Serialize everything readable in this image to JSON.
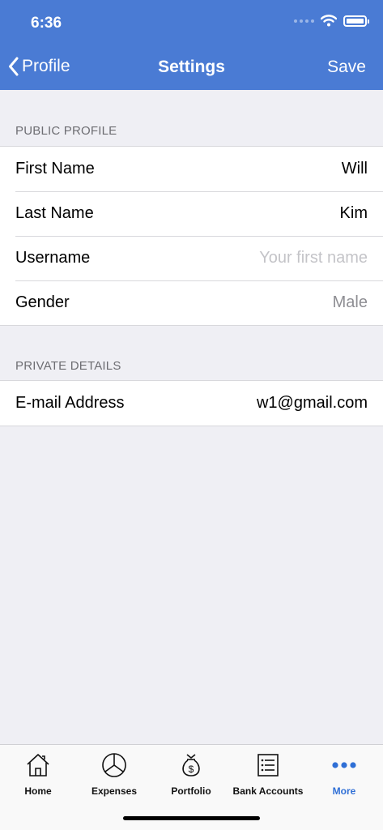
{
  "status_bar": {
    "time": "6:36",
    "icons": [
      "signal-dots-icon",
      "wifi-icon",
      "battery-icon"
    ]
  },
  "nav": {
    "back_label": "Profile",
    "title": "Settings",
    "save_label": "Save"
  },
  "sections": [
    {
      "header": "PUBLIC PROFILE",
      "rows": [
        {
          "label": "First Name",
          "value": "Will",
          "placeholder": ""
        },
        {
          "label": "Last Name",
          "value": "Kim",
          "placeholder": ""
        },
        {
          "label": "Username",
          "value": "",
          "placeholder": "Your first name"
        },
        {
          "label": "Gender",
          "value": "Male",
          "placeholder": ""
        }
      ]
    },
    {
      "header": "PRIVATE DETAILS",
      "rows": [
        {
          "label": "E-mail Address",
          "value": "w1@gmail.com",
          "placeholder": ""
        }
      ]
    }
  ],
  "tabbar": {
    "tabs": [
      {
        "label": "Home",
        "icon": "house-icon"
      },
      {
        "label": "Expenses",
        "icon": "pie-chart-icon"
      },
      {
        "label": "Portfolio",
        "icon": "money-bag-icon"
      },
      {
        "label": "Bank Accounts",
        "icon": "list-icon"
      },
      {
        "label": "More",
        "icon": "more-dots-icon"
      }
    ],
    "active": "More"
  },
  "colors": {
    "accent": "#4A7BD4",
    "tab_active": "#2F6FD6",
    "background": "#EFEFF4"
  }
}
